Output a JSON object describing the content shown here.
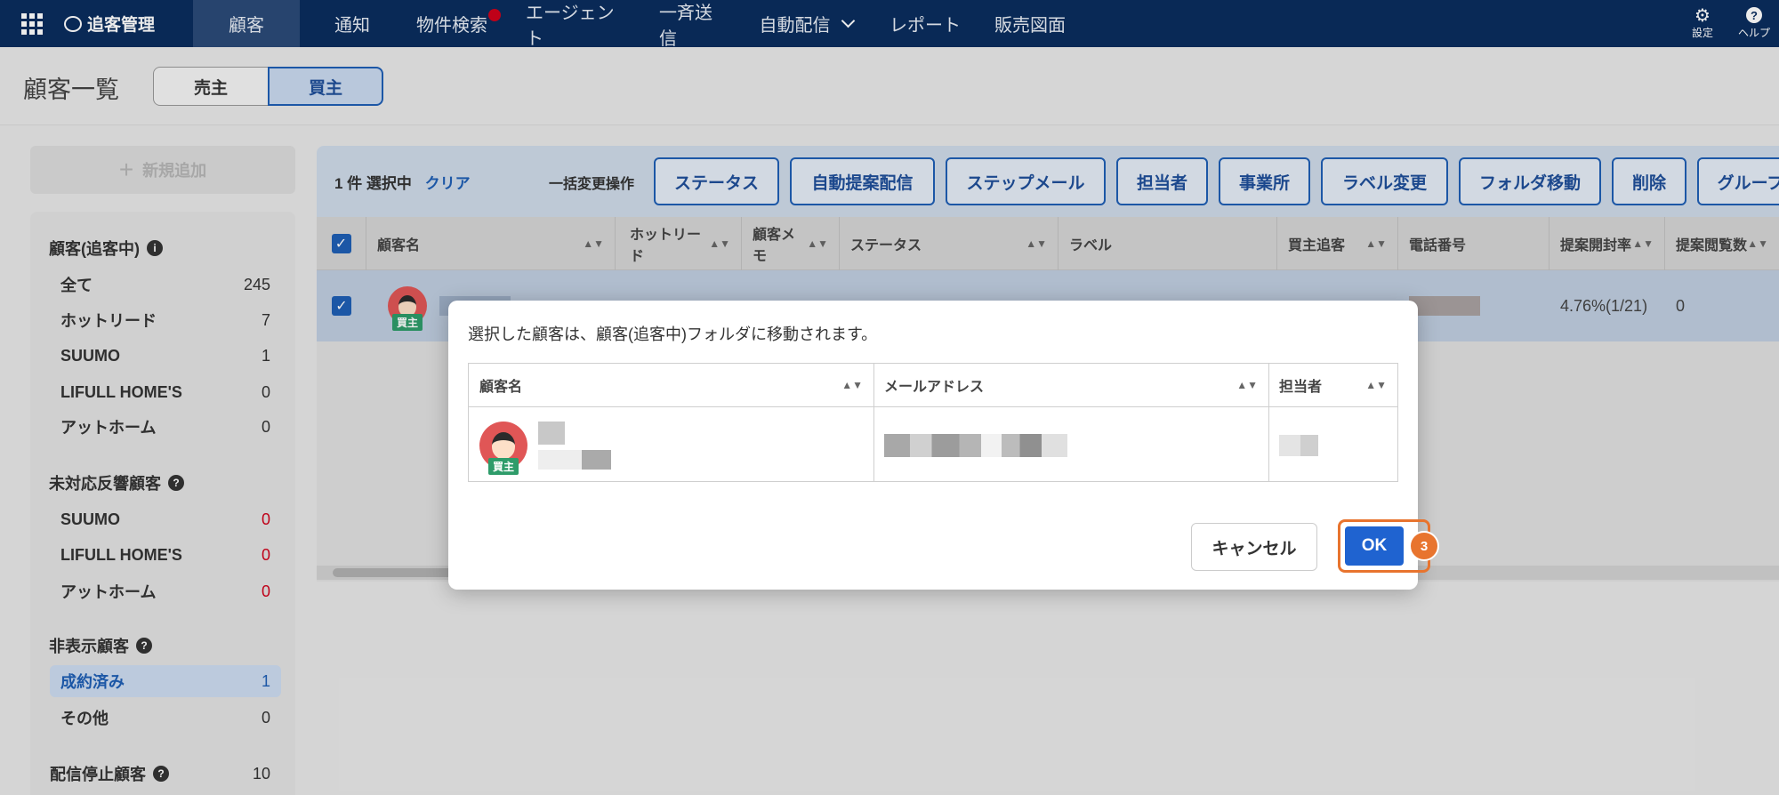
{
  "nav": {
    "brand": "追客管理",
    "items": [
      "顧客",
      "通知",
      "物件検索",
      "エージェント",
      "一斉送信",
      "自動配信",
      "レポート",
      "販売図面"
    ],
    "settings_label": "設定",
    "help_label": "ヘルプ"
  },
  "page": {
    "title": "顧客一覧",
    "seg_seller": "売主",
    "seg_buyer": "買主"
  },
  "sidebar": {
    "add_label": "新規追加",
    "sec1_title": "顧客(追客中)",
    "sec1_rows": [
      {
        "label": "全て",
        "count": "245"
      },
      {
        "label": "ホットリード",
        "count": "7"
      },
      {
        "label": "SUUMO",
        "count": "1"
      },
      {
        "label": "LIFULL HOME'S",
        "count": "0"
      },
      {
        "label": "アットホーム",
        "count": "0"
      }
    ],
    "sec2_title": "未対応反響顧客",
    "sec2_rows": [
      {
        "label": "SUUMO",
        "count": "0"
      },
      {
        "label": "LIFULL HOME'S",
        "count": "0"
      },
      {
        "label": "アットホーム",
        "count": "0"
      }
    ],
    "sec3_title": "非表示顧客",
    "sec3_rows": [
      {
        "label": "成約済み",
        "count": "1"
      },
      {
        "label": "その他",
        "count": "0"
      }
    ],
    "sec4_title": "配信停止顧客",
    "sec4_count": "10"
  },
  "toolbar": {
    "selected": "1 件 選択中",
    "clear": "クリア",
    "bulk_label": "一括変更操作",
    "buttons": [
      "ステータス",
      "自動提案配信",
      "ステップメール",
      "担当者",
      "事業所",
      "ラベル変更",
      "フォルダ移動",
      "削除",
      "グループ"
    ]
  },
  "table": {
    "headers": [
      "顧客名",
      "ホットリード",
      "顧客メモ",
      "ステータス",
      "ラベル",
      "買主追客",
      "電話番号",
      "提案開封率",
      "提案閲覧数"
    ],
    "row": {
      "open_rate": "4.76%(1/21)",
      "views": "0",
      "tag": "買主"
    }
  },
  "modal": {
    "message": "選択した顧客は、顧客(追客中)フォルダに移動されます。",
    "headers": [
      "顧客名",
      "メールアドレス",
      "担当者"
    ],
    "tag": "買主",
    "cancel": "キャンセル",
    "ok": "OK",
    "step": "3"
  },
  "colors": {
    "nav_bg": "#0a2d5e",
    "accent": "#1f5fb5",
    "ok_button": "#1f63d0",
    "highlight": "#e8742e",
    "warning_red": "#d0021b"
  }
}
